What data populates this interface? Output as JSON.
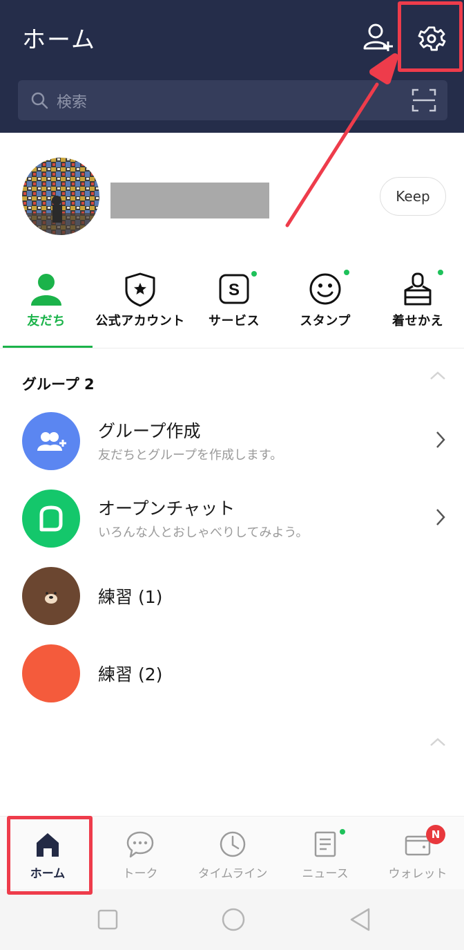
{
  "header": {
    "title": "ホーム",
    "search_placeholder": "検索",
    "icons": [
      "add-friend-icon",
      "gear-icon",
      "search-icon",
      "qr-scan-icon"
    ]
  },
  "profile": {
    "keep_label": "Keep"
  },
  "tabs": [
    {
      "label": "友だち",
      "icon": "person-icon",
      "active": true
    },
    {
      "label": "公式アカウント",
      "icon": "shield-star-icon"
    },
    {
      "label": "サービス",
      "icon": "service-s-icon",
      "new": true
    },
    {
      "label": "スタンプ",
      "icon": "smiley-icon",
      "new": true
    },
    {
      "label": "着せかえ",
      "icon": "brush-icon",
      "new": true
    }
  ],
  "groups": {
    "heading": "グループ 2",
    "items": [
      {
        "title": "グループ作成",
        "subtitle": "友だちとグループを作成します。",
        "icon": "add-group-icon"
      },
      {
        "title": "オープンチャット",
        "subtitle": "いろんな人とおしゃべりしてみよう。",
        "icon": "open-chat-icon"
      },
      {
        "title": "練習 (1)",
        "icon": "bear-avatar"
      },
      {
        "title": "練習 (2)",
        "icon": "orange-avatar"
      }
    ]
  },
  "bottom_nav": [
    {
      "label": "ホーム",
      "icon": "home-icon",
      "active": true
    },
    {
      "label": "トーク",
      "icon": "chat-bubble-icon"
    },
    {
      "label": "タイムライン",
      "icon": "clock-icon"
    },
    {
      "label": "ニュース",
      "icon": "news-icon",
      "new": true
    },
    {
      "label": "ウォレット",
      "icon": "wallet-icon",
      "badge": "N"
    }
  ],
  "colors": {
    "header_bg": "#252d4a",
    "accent_green": "#1bb34a",
    "highlight_red": "#ee3c4b"
  }
}
